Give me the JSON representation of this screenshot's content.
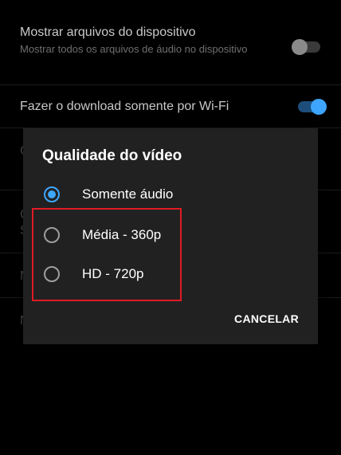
{
  "settings": {
    "show_device_files": {
      "title": "Mostrar arquivos do dispositivo",
      "subtitle": "Mostrar todos os arquivos de áudio no dispositivo",
      "toggle_state": "off"
    },
    "wifi_only": {
      "title": "Fazer o download somente por Wi-Fi",
      "toggle_state": "on"
    },
    "obscured_row_letters": [
      "C",
      "C",
      "S",
      "N",
      "N"
    ]
  },
  "dialog": {
    "title": "Qualidade do vídeo",
    "options": [
      {
        "label": "Somente áudio",
        "selected": true
      },
      {
        "label": "Média - 360p",
        "selected": false
      },
      {
        "label": "HD - 720p",
        "selected": false
      }
    ],
    "cancel_label": "CANCELAR"
  },
  "colors": {
    "accent": "#3ea6ff",
    "highlight_border": "#e01b24",
    "dialog_bg": "#212121",
    "page_bg": "#000000"
  }
}
